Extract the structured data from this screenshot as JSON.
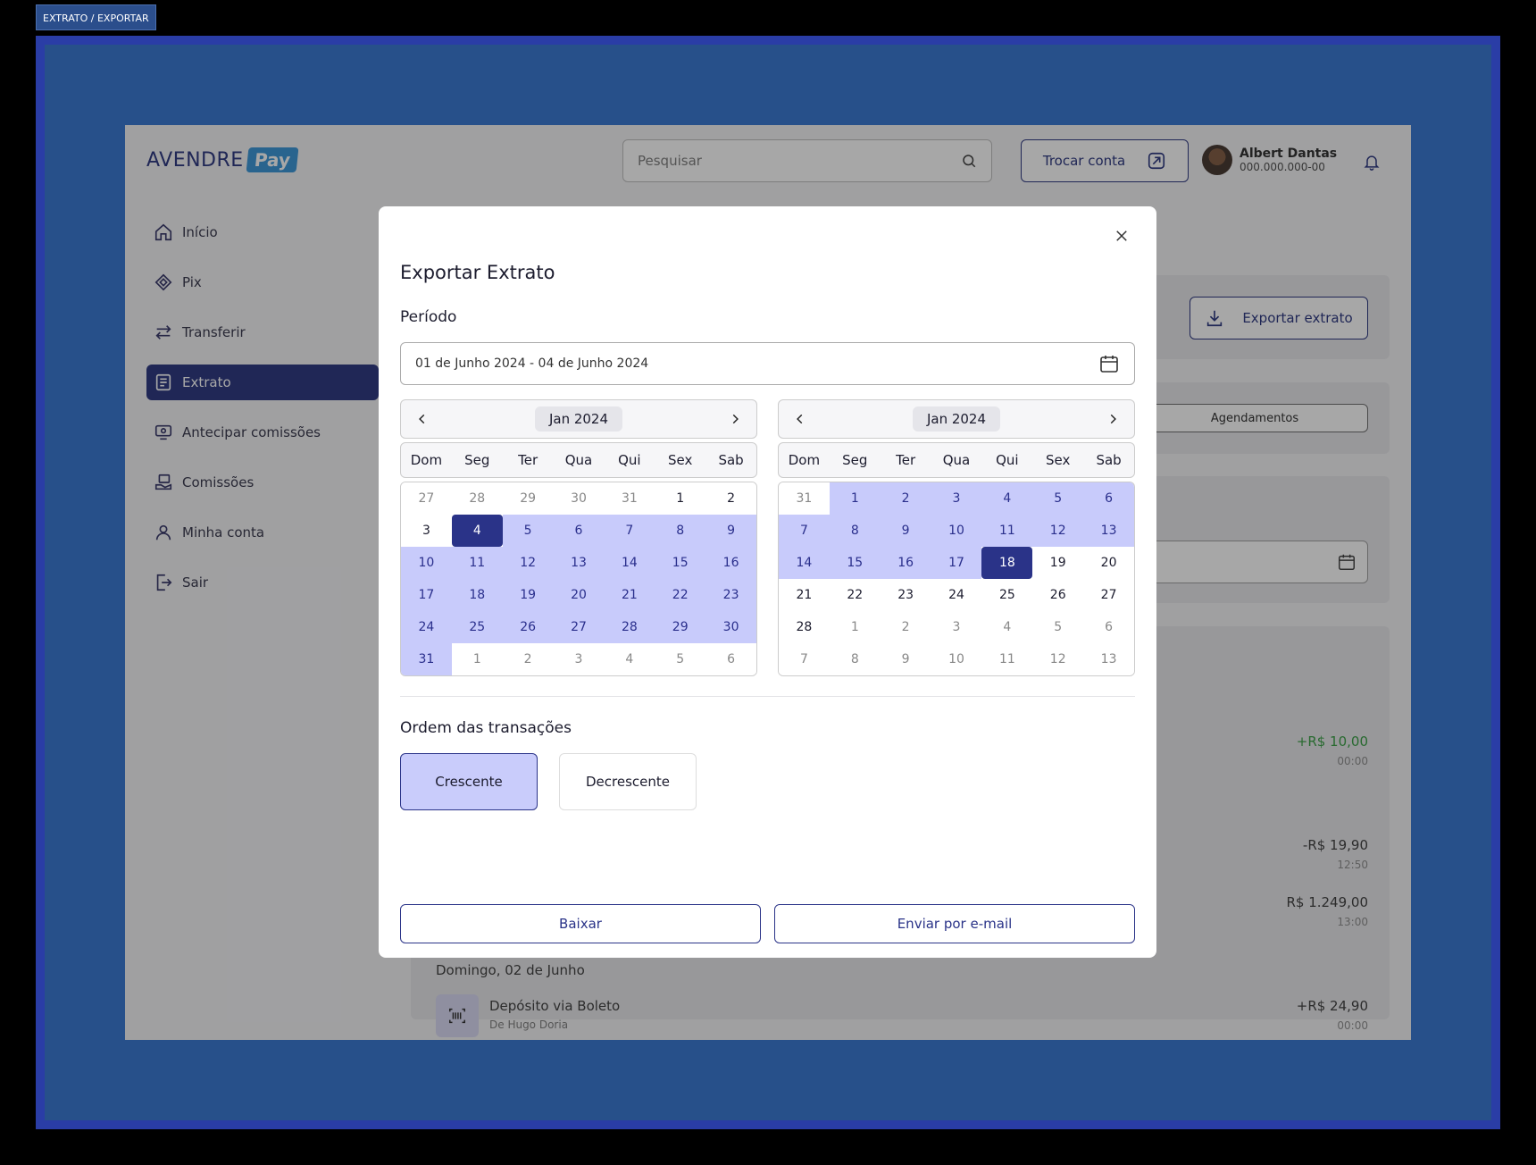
{
  "frame_label": "EXTRATO / EXPORTAR",
  "header": {
    "logo_text": "AVENDRE",
    "logo_badge": "Pay",
    "search_placeholder": "Pesquisar",
    "switch_account": "Trocar conta",
    "user_name": "Albert Dantas",
    "user_document": "000.000.000-00"
  },
  "sidebar": {
    "items": [
      {
        "label": "Início",
        "icon": "home-icon"
      },
      {
        "label": "Pix",
        "icon": "pix-icon"
      },
      {
        "label": "Transferir",
        "icon": "transfer-icon"
      },
      {
        "label": "Extrato",
        "icon": "statement-icon",
        "active": true
      },
      {
        "label": "Antecipar comissões",
        "icon": "advance-icon"
      },
      {
        "label": "Comissões",
        "icon": "commissions-icon"
      },
      {
        "label": "Minha conta",
        "icon": "user-icon"
      },
      {
        "label": "Sair",
        "icon": "logout-icon"
      }
    ]
  },
  "background": {
    "export_button": "Exportar extrato",
    "tab_agendamentos": "Agendamentos",
    "amounts": [
      {
        "value": "+R$ 10,00",
        "time": "00:00",
        "positive": true
      },
      {
        "value": "-R$ 19,90",
        "time": "12:50",
        "positive": false
      },
      {
        "value": "R$ 1.249,00",
        "time": "13:00",
        "positive": false
      }
    ],
    "day_label": "Domingo, 02 de Junho",
    "transaction": {
      "title": "Depósito via Boleto",
      "subtitle": "De Hugo Doria",
      "value": "+R$ 24,90",
      "time": "00:00"
    }
  },
  "modal": {
    "title": "Exportar Extrato",
    "period_label": "Período",
    "date_range": "01 de Junho 2024 - 04 de Junho 2024",
    "order_label": "Ordem das transações",
    "order_options": [
      "Crescente",
      "Decrescente"
    ],
    "order_selected": "Crescente",
    "download_button": "Baixar",
    "email_button": "Enviar por e-mail",
    "weekdays": [
      "Dom",
      "Seg",
      "Ter",
      "Qua",
      "Qui",
      "Sex",
      "Sab"
    ],
    "calendars": [
      {
        "month": "Jan 2024",
        "days": [
          {
            "d": "27",
            "s": "out"
          },
          {
            "d": "28",
            "s": "out"
          },
          {
            "d": "29",
            "s": "out"
          },
          {
            "d": "30",
            "s": "out"
          },
          {
            "d": "31",
            "s": "out"
          },
          {
            "d": "1",
            "s": "in"
          },
          {
            "d": "2",
            "s": "in"
          },
          {
            "d": "3",
            "s": "in"
          },
          {
            "d": "4",
            "s": "sel"
          },
          {
            "d": "5",
            "s": "range"
          },
          {
            "d": "6",
            "s": "range"
          },
          {
            "d": "7",
            "s": "range"
          },
          {
            "d": "8",
            "s": "range"
          },
          {
            "d": "9",
            "s": "range"
          },
          {
            "d": "10",
            "s": "range"
          },
          {
            "d": "11",
            "s": "range"
          },
          {
            "d": "12",
            "s": "range"
          },
          {
            "d": "13",
            "s": "range"
          },
          {
            "d": "14",
            "s": "range"
          },
          {
            "d": "15",
            "s": "range"
          },
          {
            "d": "16",
            "s": "range"
          },
          {
            "d": "17",
            "s": "range"
          },
          {
            "d": "18",
            "s": "range"
          },
          {
            "d": "19",
            "s": "range"
          },
          {
            "d": "20",
            "s": "range"
          },
          {
            "d": "21",
            "s": "range"
          },
          {
            "d": "22",
            "s": "range"
          },
          {
            "d": "23",
            "s": "range"
          },
          {
            "d": "24",
            "s": "range"
          },
          {
            "d": "25",
            "s": "range"
          },
          {
            "d": "26",
            "s": "range"
          },
          {
            "d": "27",
            "s": "range"
          },
          {
            "d": "28",
            "s": "range"
          },
          {
            "d": "29",
            "s": "range"
          },
          {
            "d": "30",
            "s": "range"
          },
          {
            "d": "31",
            "s": "range"
          },
          {
            "d": "1",
            "s": "out"
          },
          {
            "d": "2",
            "s": "out"
          },
          {
            "d": "3",
            "s": "out"
          },
          {
            "d": "4",
            "s": "out"
          },
          {
            "d": "5",
            "s": "out"
          },
          {
            "d": "6",
            "s": "out"
          }
        ]
      },
      {
        "month": "Jan 2024",
        "days": [
          {
            "d": "31",
            "s": "out"
          },
          {
            "d": "1",
            "s": "range"
          },
          {
            "d": "2",
            "s": "range"
          },
          {
            "d": "3",
            "s": "range"
          },
          {
            "d": "4",
            "s": "range"
          },
          {
            "d": "5",
            "s": "range"
          },
          {
            "d": "6",
            "s": "range"
          },
          {
            "d": "7",
            "s": "range"
          },
          {
            "d": "8",
            "s": "range"
          },
          {
            "d": "9",
            "s": "range"
          },
          {
            "d": "10",
            "s": "range"
          },
          {
            "d": "11",
            "s": "range"
          },
          {
            "d": "12",
            "s": "range"
          },
          {
            "d": "13",
            "s": "range"
          },
          {
            "d": "14",
            "s": "range"
          },
          {
            "d": "15",
            "s": "range"
          },
          {
            "d": "16",
            "s": "range"
          },
          {
            "d": "17",
            "s": "range"
          },
          {
            "d": "18",
            "s": "sel"
          },
          {
            "d": "19",
            "s": "in"
          },
          {
            "d": "20",
            "s": "in"
          },
          {
            "d": "21",
            "s": "in"
          },
          {
            "d": "22",
            "s": "in"
          },
          {
            "d": "23",
            "s": "in"
          },
          {
            "d": "24",
            "s": "in"
          },
          {
            "d": "25",
            "s": "in"
          },
          {
            "d": "26",
            "s": "in"
          },
          {
            "d": "27",
            "s": "in"
          },
          {
            "d": "28",
            "s": "in"
          },
          {
            "d": "1",
            "s": "out"
          },
          {
            "d": "2",
            "s": "out"
          },
          {
            "d": "3",
            "s": "out"
          },
          {
            "d": "4",
            "s": "out"
          },
          {
            "d": "5",
            "s": "out"
          },
          {
            "d": "6",
            "s": "out"
          },
          {
            "d": "7",
            "s": "out"
          },
          {
            "d": "8",
            "s": "out"
          },
          {
            "d": "9",
            "s": "out"
          },
          {
            "d": "10",
            "s": "out"
          },
          {
            "d": "11",
            "s": "out"
          },
          {
            "d": "12",
            "s": "out"
          },
          {
            "d": "13",
            "s": "out"
          }
        ]
      }
    ]
  },
  "colors": {
    "primary": "#1e2a78",
    "range": "#c8cbfb",
    "selected": "#2a3388",
    "positive": "#2d9a3a",
    "frame": "#27508a"
  }
}
